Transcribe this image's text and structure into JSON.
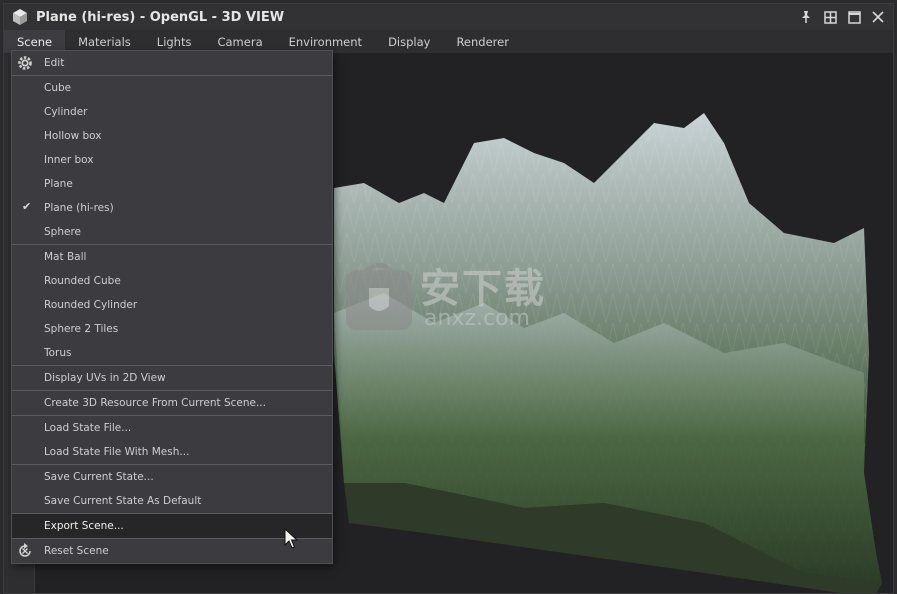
{
  "window": {
    "title": "Plane (hi-res) - OpenGL - 3D VIEW"
  },
  "menubar": {
    "tabs": [
      "Scene",
      "Materials",
      "Lights",
      "Camera",
      "Environment",
      "Display",
      "Renderer"
    ],
    "active": "Scene"
  },
  "scene_menu": {
    "edit": "Edit",
    "primitives": [
      "Cube",
      "Cylinder",
      "Hollow box",
      "Inner box",
      "Plane",
      "Plane (hi-res)",
      "Sphere"
    ],
    "checked": "Plane (hi-res)",
    "objects": [
      "Mat Ball",
      "Rounded Cube",
      "Rounded Cylinder",
      "Sphere 2 Tiles",
      "Torus"
    ],
    "display_uvs": "Display UVs in 2D View",
    "create_resource": "Create 3D Resource From Current Scene...",
    "load_state": "Load State File...",
    "load_state_mesh": "Load State File With Mesh...",
    "save_state": "Save Current State...",
    "save_default": "Save Current State As Default",
    "export_scene": "Export Scene...",
    "reset_scene": "Reset Scene"
  },
  "watermark": {
    "cn": "安下载",
    "en": "anxz.com"
  },
  "colors": {
    "menu_bg": "#3c3c40",
    "hover_bg": "#262628",
    "terrain_green": "#3e5a36",
    "terrain_snow": "#c9d3d6"
  }
}
